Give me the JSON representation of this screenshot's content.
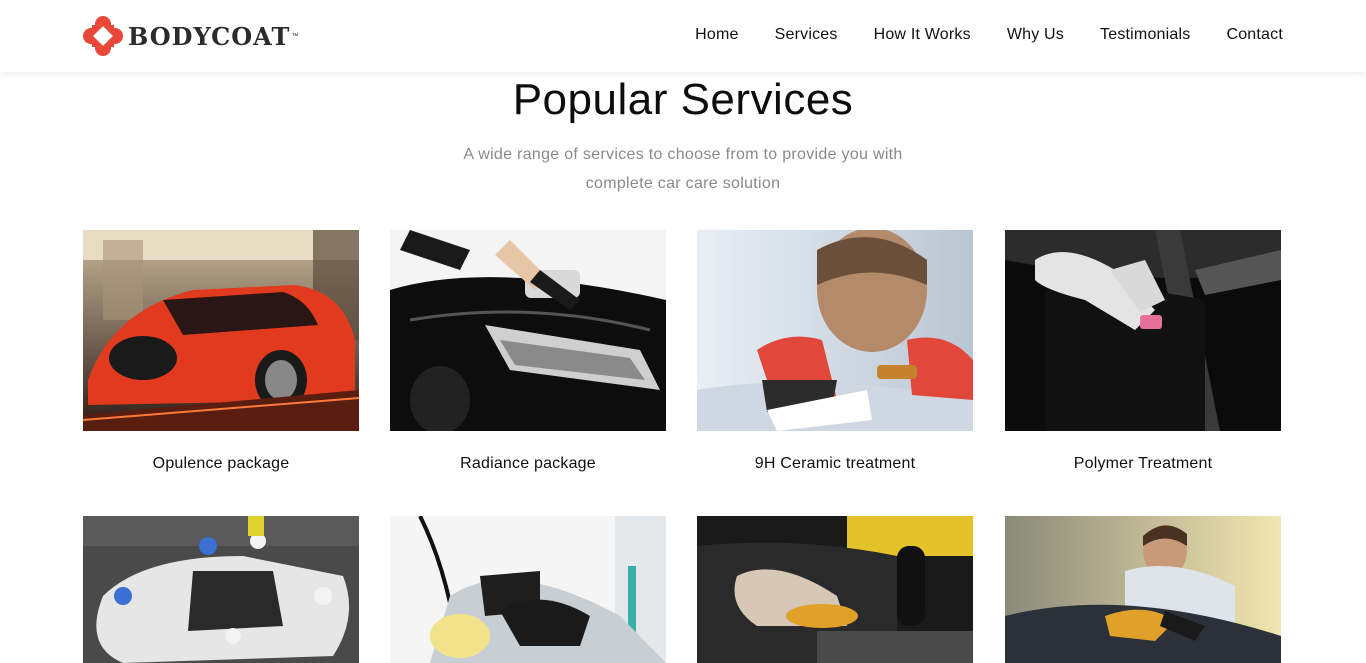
{
  "brand": {
    "name": "BODYCOAT",
    "tm": "™"
  },
  "nav": [
    {
      "label": "Home"
    },
    {
      "label": "Services"
    },
    {
      "label": "How It Works"
    },
    {
      "label": "Why Us"
    },
    {
      "label": "Testimonials"
    },
    {
      "label": "Contact"
    }
  ],
  "section": {
    "title": "Popular Services",
    "subtitle": "A wide range of services to choose from to provide you with complete car care solution"
  },
  "services": [
    {
      "label": "Opulence package",
      "icon": "red-sports-car-photo"
    },
    {
      "label": "Radiance package",
      "icon": "car-polishing-photo"
    },
    {
      "label": "9H Ceramic treatment",
      "icon": "ceramic-coating-photo"
    },
    {
      "label": "Polymer Treatment",
      "icon": "polymer-glove-photo"
    },
    {
      "label": "",
      "icon": "team-washing-convertible-photo"
    },
    {
      "label": "",
      "icon": "mirror-detailing-photo"
    },
    {
      "label": "",
      "icon": "interior-gearshift-cleaning-photo"
    },
    {
      "label": "",
      "icon": "man-waxing-car-photo"
    }
  ],
  "colors": {
    "brand_red": "#e8473a",
    "text": "#111111",
    "muted": "#8a8a8a"
  }
}
